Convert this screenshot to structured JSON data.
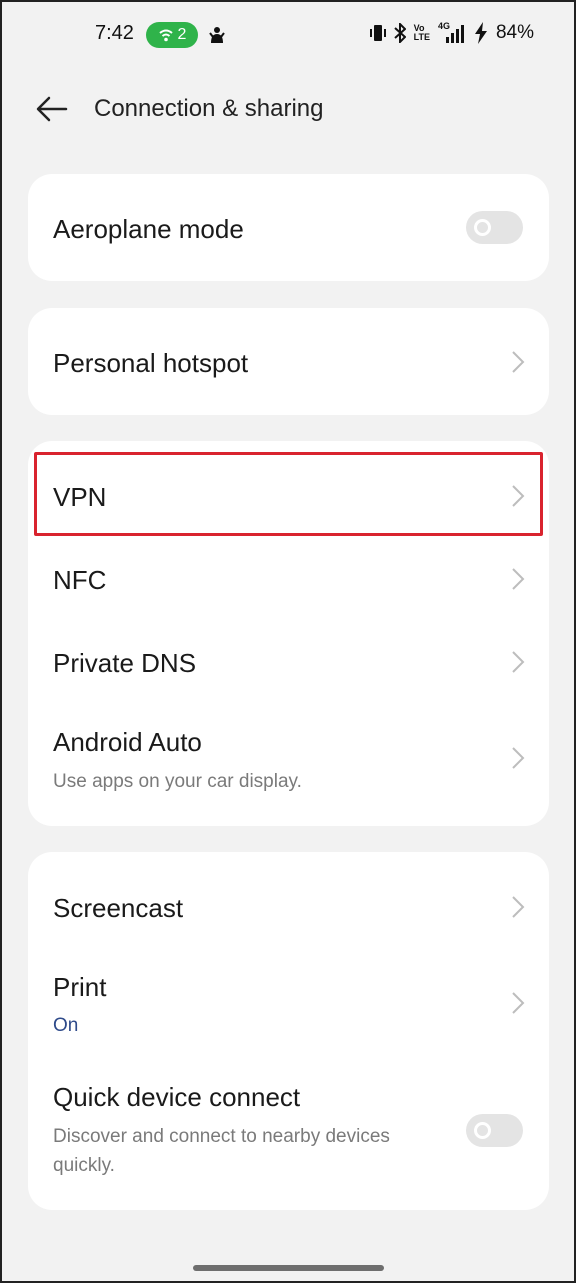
{
  "status_bar": {
    "time": "7:42",
    "hotspot_count": "2",
    "battery": "84%",
    "lte_top": "Vo",
    "lte_bottom": "LTE",
    "network": "4G"
  },
  "header": {
    "title": "Connection & sharing"
  },
  "cards": {
    "aeroplane": {
      "title": "Aeroplane mode",
      "toggle_on": false
    },
    "hotspot": {
      "title": "Personal hotspot"
    },
    "vpn": {
      "title": "VPN"
    },
    "nfc": {
      "title": "NFC"
    },
    "private_dns": {
      "title": "Private DNS"
    },
    "android_auto": {
      "title": "Android Auto",
      "subtitle": "Use apps on your car display."
    },
    "screencast": {
      "title": "Screencast"
    },
    "print": {
      "title": "Print",
      "subtitle": "On"
    },
    "quick_connect": {
      "title": "Quick device connect",
      "subtitle": "Discover and connect to nearby devices quickly.",
      "toggle_on": false
    }
  },
  "colors": {
    "background": "#f2f2f2",
    "card": "#ffffff",
    "hotspot_pill": "#2fb34a",
    "highlight": "#d9232e",
    "accent_text": "#2e4a8a"
  }
}
